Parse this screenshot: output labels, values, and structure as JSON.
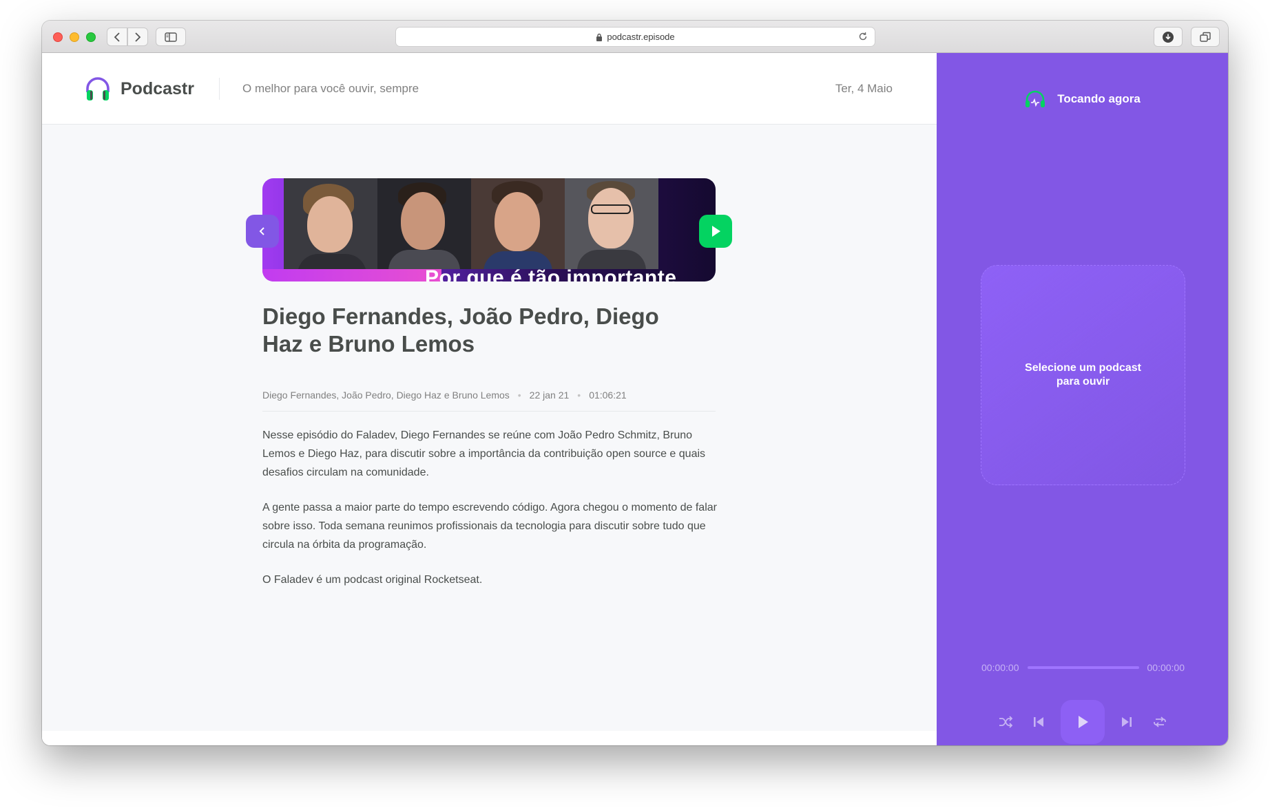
{
  "browser": {
    "url": "podcastr.episode"
  },
  "header": {
    "logo_text": "Podcastr",
    "tagline": "O melhor para você ouvir, sempre",
    "date": "Ter, 4 Maio"
  },
  "episode": {
    "thumbnail_caption": "Por que é tão importante",
    "title": "Diego Fernandes, João Pedro, Diego Haz e Bruno Lemos",
    "members": "Diego Fernandes, João Pedro, Diego Haz e Bruno Lemos",
    "published_at": "22 jan 21",
    "duration": "01:06:21",
    "description": [
      "Nesse episódio do Faladev, Diego Fernandes se reúne com João Pedro Schmitz, Bruno Lemos e Diego Haz, para discutir sobre a importância da contribuição open source e quais desafios circulam na comunidade.",
      "A gente passa a maior parte do tempo escrevendo código. Agora chegou o momento de falar sobre isso. Toda semana reunimos profissionais da tecnologia para discutir sobre tudo que circula na órbita da programação.",
      "O Faladev é um podcast original Rocketseat."
    ]
  },
  "player": {
    "title": "Tocando agora",
    "empty_message": "Selecione um podcast para ouvir",
    "current_time": "00:00:00",
    "total_time": "00:00:00",
    "progress": 0
  },
  "colors": {
    "purple": "#8257e5",
    "green": "#04d361",
    "text": "#494d4b",
    "muted": "#808080"
  },
  "icons": {
    "back": "chevron-left-icon",
    "play_episode": "play-icon",
    "shuffle": "shuffle-icon",
    "previous": "skip-previous-icon",
    "play": "play-icon",
    "next": "skip-next-icon",
    "repeat": "repeat-icon"
  }
}
